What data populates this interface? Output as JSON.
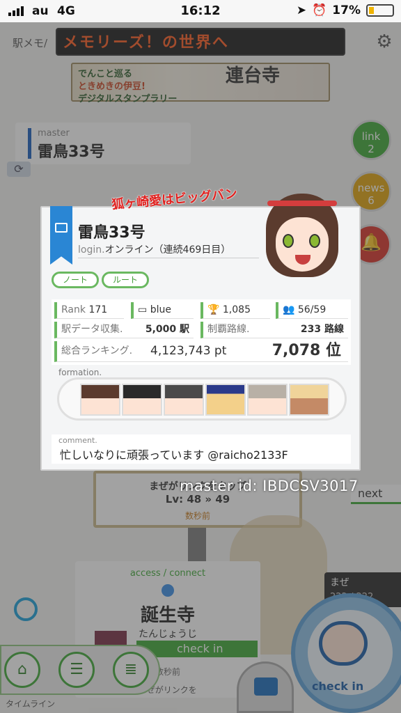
{
  "status_bar": {
    "carrier": "au",
    "network": "4G",
    "time": "16:12",
    "battery": "17%"
  },
  "background": {
    "logo": "駅メモ/",
    "marquee": "メモリーズ！の世界へ",
    "banner": {
      "line1": "でんこと巡る",
      "line2": "ときめきの伊豆!",
      "line3": "デジタルスタンプラリー",
      "kanji": "連台寺"
    },
    "master_label": "master",
    "master_name": "雷鳥33号",
    "link_label": "link",
    "link_count": "2",
    "news_label": "news",
    "news_count": "6",
    "board": {
      "line1": "まぜがリンクをタップ",
      "line2": "Lv: 48 » 49",
      "time": "数秒前"
    },
    "master_id": "master id: IBDCSV3017",
    "next_label": "next",
    "station": {
      "access": "access / connect",
      "name": "誕生寺",
      "kana": "たんじょうじ",
      "check_in_bar": "check in",
      "time": "数秒前",
      "footer": "まぜがリンクを"
    },
    "maze": {
      "name": "まぜ",
      "value": "222 / 222"
    },
    "timeline": "タイムライン",
    "check_in": "check in"
  },
  "speech": "狐ヶ崎愛はビッグバン",
  "modal": {
    "name": "雷鳥33号",
    "status_prefix": "login.",
    "status": "オンライン（連続469日目）",
    "buttons": {
      "note": "ノート",
      "route": "ルート"
    },
    "stats": {
      "rank_label": "Rank",
      "rank": "171",
      "card": "blue",
      "trophies": "1,085",
      "friends": "56/59",
      "stations_label": "駅データ収集.",
      "stations": "5,000 駅",
      "lines_label": "制覇路線.",
      "lines": "233 路線",
      "ranking_label": "総合ランキング.",
      "points": "4,123,743 pt",
      "position": "7,078 位"
    },
    "formation_label": "formation.",
    "comment_label": "comment.",
    "comment": "忙しいなりに頑張っています @raicho2133F"
  }
}
